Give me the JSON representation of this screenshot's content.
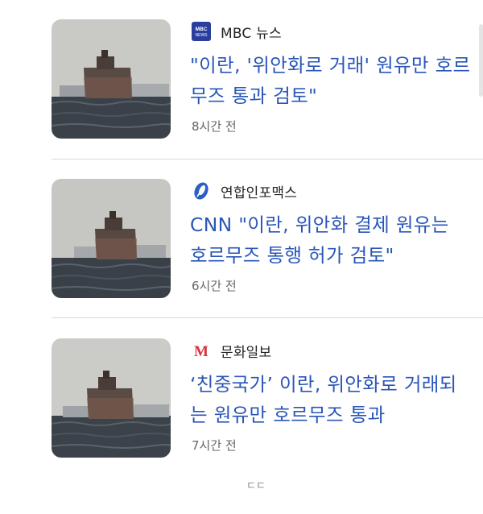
{
  "feed": {
    "items": [
      {
        "source": "MBC 뉴스",
        "source_logo": "mbc-news-logo",
        "headline": "\"이란, '위안화로 거래' 원유만 호르무즈 통과 검토\"",
        "time": "8시간 전"
      },
      {
        "source": "연합인포맥스",
        "source_logo": "yonhap-infomax-logo",
        "headline": "CNN \"이란, 위안화 결제 원유는 호르무즈 통행 허가 검토\"",
        "time": "6시간 전"
      },
      {
        "source": "문화일보",
        "source_logo": "munhwa-ilbo-logo",
        "headline": "‘친중국가’ 이란, 위안화로 거래되는 원유만 호르무즈 통과",
        "time": "7시간 전"
      }
    ]
  },
  "footer": {
    "hint": "ㄷㄷ"
  },
  "logos": {
    "mbc_text": "MBC NEWS",
    "munhwa_text": "M"
  },
  "colors": {
    "headline": "#2a56b8",
    "mbc_logo_bg": "#2a3f9d",
    "yonhap_logo": "#2b5fc7",
    "munhwa_logo": "#d6333a"
  }
}
